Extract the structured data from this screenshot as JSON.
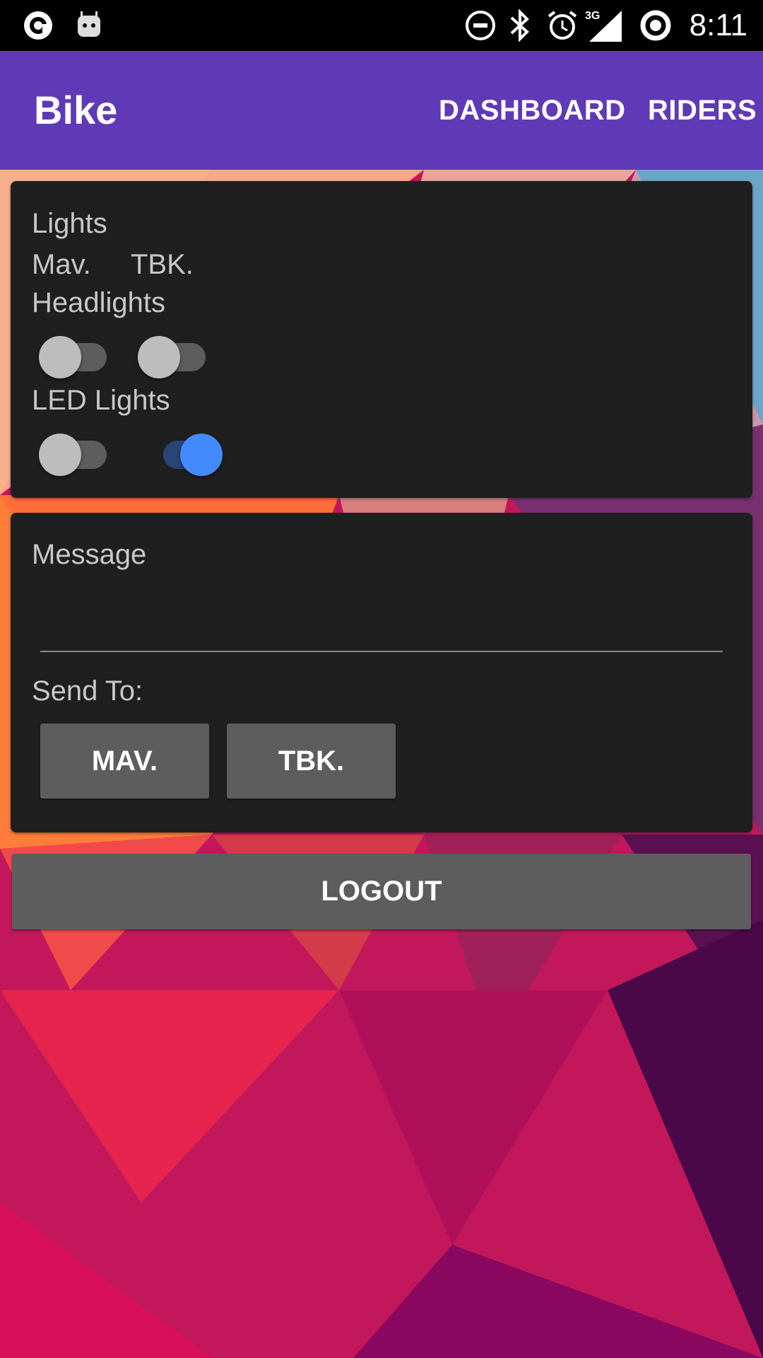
{
  "status_bar": {
    "time": "8:11",
    "network": "3G",
    "icons_left": [
      "assistant-icon",
      "android-icon"
    ],
    "icons_right": [
      "do-not-disturb-icon",
      "bluetooth-icon",
      "alarm-icon",
      "signal-3g-icon",
      "sync-icon"
    ]
  },
  "app_bar": {
    "title": "Bike",
    "nav": [
      "DASHBOARD",
      "RIDERS"
    ],
    "color": "#6039b7"
  },
  "lights_card": {
    "title": "Lights",
    "col1": "Mav.",
    "col2": "TBK.",
    "headlights_label": "Headlights",
    "led_label": "LED Lights",
    "headlights": [
      false,
      false
    ],
    "led": [
      false,
      true
    ]
  },
  "message_card": {
    "message_label": "Message",
    "message_value": "",
    "send_to_label": "Send To:",
    "buttons": [
      "MAV.",
      "TBK."
    ]
  },
  "logout_label": "LOGOUT",
  "colors": {
    "accent": "#448aff",
    "card": "#1f1f1f",
    "button": "#5d5d5e"
  }
}
